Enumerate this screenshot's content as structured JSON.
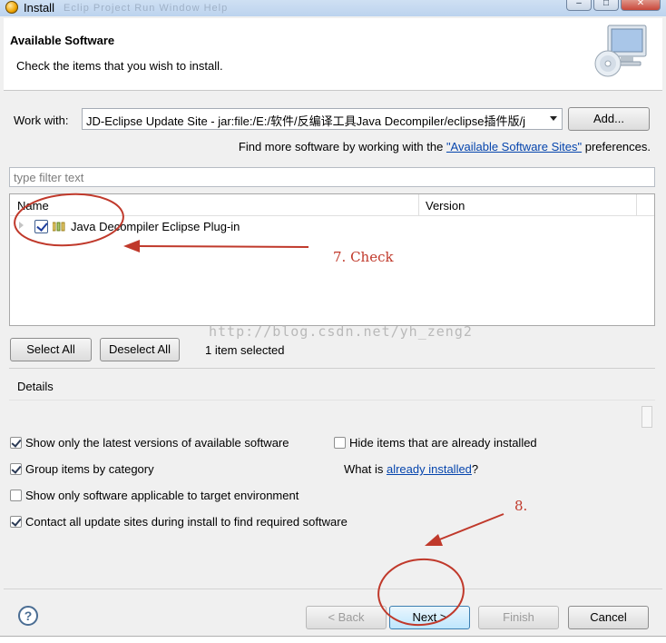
{
  "window": {
    "title": "Install",
    "title_ghost": "Eclip  Project  Run  Window  Help"
  },
  "header": {
    "title": "Available Software",
    "description": "Check the items that you wish to install.",
    "graphic_icon": "install-cd-monitor-icon"
  },
  "work_with": {
    "label": "Work with:",
    "value": "JD-Eclipse Update Site - jar:file:/E:/软件/反编译工具Java Decompiler/eclipse插件版/j",
    "add_label": "Add..."
  },
  "find_more": {
    "prefix": "Find more software by working with the ",
    "link": "\"Available Software Sites\"",
    "suffix": " preferences."
  },
  "filter": {
    "placeholder": "type filter text"
  },
  "table": {
    "columns": [
      "Name",
      "Version"
    ],
    "rows": [
      {
        "label": "Java Decompiler Eclipse Plug-in",
        "version": "",
        "checked": true,
        "icon": "category-icon"
      }
    ]
  },
  "selection": {
    "select_all": "Select All",
    "deselect_all": "Deselect All",
    "count_text": "1 item selected"
  },
  "details": {
    "label": "Details"
  },
  "options": {
    "latest_versions": {
      "label": "Show only the latest versions of available software",
      "checked": true
    },
    "hide_installed": {
      "label": "Hide items that are already installed",
      "checked": false
    },
    "group_by_category": {
      "label": "Group items by category",
      "checked": true
    },
    "already_installed_prefix": "What is ",
    "already_installed_link": "already installed",
    "already_installed_suffix": "?",
    "target_env": {
      "label": "Show only software applicable to target environment",
      "checked": false
    },
    "contact_sites": {
      "label": "Contact all update sites during install to find required software",
      "checked": true
    }
  },
  "buttons": {
    "back": "< Back",
    "next": "Next >",
    "finish": "Finish",
    "cancel": "Cancel"
  },
  "annotations": {
    "step7": "7. Check",
    "step8": "8."
  },
  "watermark": "http://blog.csdn.net/yh_zeng2",
  "colors": {
    "annotation_red": "#c0392b",
    "link": "#0645ad"
  }
}
